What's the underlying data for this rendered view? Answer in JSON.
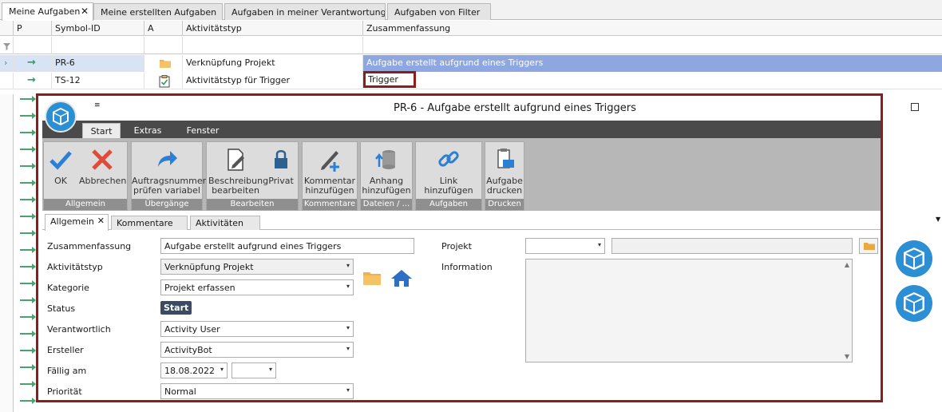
{
  "top_tabs": [
    {
      "label": "Meine Aufgaben",
      "active": true
    },
    {
      "label": "Meine erstellten Aufgaben",
      "active": false
    },
    {
      "label": "Aufgaben in meiner Verantwortung",
      "active": false
    },
    {
      "label": "Aufgaben von Filter",
      "active": false
    }
  ],
  "grid": {
    "headers": [
      "P",
      "Symbol-ID",
      "A",
      "Aktivitätstyp",
      "Zusammenfassung"
    ],
    "rows": [
      {
        "symbol_id": "PR-6",
        "type": "Verknüpfung Projekt",
        "summary": "Aufgabe erstellt aufgrund eines Triggers",
        "icon": "folder-icon",
        "selected": true
      },
      {
        "symbol_id": "TS-12",
        "type": "Aktivitätstyp für Trigger",
        "summary": "Trigger",
        "icon": "clipboard-icon",
        "selected": false
      }
    ]
  },
  "dialog": {
    "title": "PR-6 - Aufgabe erstellt aufgrund eines Triggers",
    "quick_access": "≡",
    "menu_tabs": [
      {
        "label": "Start",
        "active": true
      },
      {
        "label": "Extras",
        "active": false
      },
      {
        "label": "Fenster",
        "active": false
      }
    ],
    "ribbon": {
      "groups": {
        "allgemein": "Allgemein",
        "uebergaenge": "Übergänge",
        "bearbeiten": "Bearbeiten",
        "kommentare": "Kommentare",
        "dateien": "Dateien / ...",
        "aufgaben": "Aufgaben",
        "drucken": "Drucken"
      },
      "buttons": {
        "ok": "OK",
        "abbrechen": "Abbrechen",
        "auftragsnummer_1": "Auftragsnummer",
        "auftragsnummer_2": "prüfen variabel",
        "beschreibung_1": "Beschreibung",
        "beschreibung_2": "bearbeiten",
        "privat": "Privat",
        "kommentar_1": "Kommentar",
        "kommentar_2": "hinzufügen",
        "anhang_1": "Anhang",
        "anhang_2": "hinzufügen",
        "link": "Link hinzufügen",
        "drucken_1": "Aufgabe",
        "drucken_2": "drucken"
      }
    },
    "inner_tabs": [
      {
        "label": "Allgemein",
        "active": true
      },
      {
        "label": "Kommentare",
        "active": false
      },
      {
        "label": "Aktivitäten",
        "active": false
      }
    ],
    "form": {
      "zusammenfassung_label": "Zusammenfassung",
      "zusammenfassung_value": "Aufgabe erstellt aufgrund eines Triggers",
      "aktivitaetstyp_label": "Aktivitätstyp",
      "aktivitaetstyp_value": "Verknüpfung Projekt",
      "kategorie_label": "Kategorie",
      "kategorie_value": "Projekt erfassen",
      "status_label": "Status",
      "status_value": "Start",
      "verantwortlich_label": "Verantwortlich",
      "verantwortlich_value": "Activity User",
      "ersteller_label": "Ersteller",
      "ersteller_value": "ActivityBot",
      "faellig_label": "Fällig am",
      "faellig_value": "18.08.2022",
      "faellig_time": "",
      "prioritaet_label": "Priorität",
      "prioritaet_value": "Normal",
      "projekt_label": "Projekt",
      "projekt_value": "",
      "projekt_text": "",
      "information_label": "Information"
    }
  },
  "colors": {
    "accent_blue": "#2d8fd3",
    "highlight_border": "#8b1d1d",
    "selected_row": "#8fa7e0",
    "ribbon_dark": "#4a4a4a"
  }
}
